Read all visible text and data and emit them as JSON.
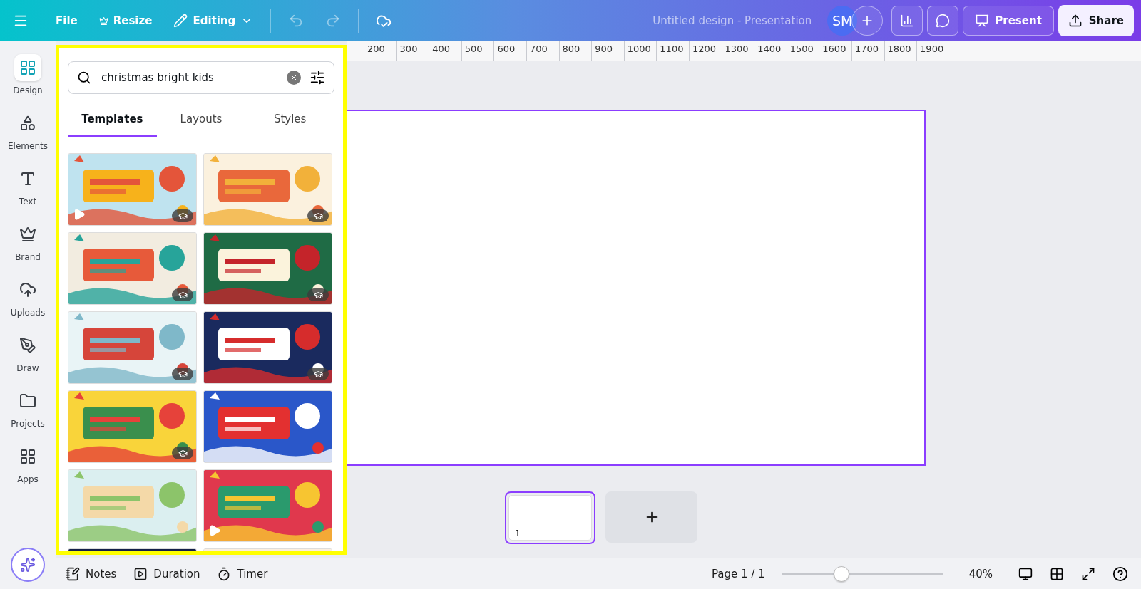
{
  "top_bar": {
    "file": "File",
    "resize": "Resize",
    "mode": "Editing",
    "title": "Untitled design - Presentation",
    "avatar": "SM",
    "present": "Present",
    "share": "Share",
    "undo_disabled": true,
    "redo_disabled": true
  },
  "rail": [
    {
      "label": "Design",
      "kind": "design",
      "selected": true
    },
    {
      "label": "Elements",
      "kind": "elements",
      "selected": false
    },
    {
      "label": "Text",
      "kind": "text",
      "selected": false
    },
    {
      "label": "Brand",
      "kind": "brand",
      "selected": false
    },
    {
      "label": "Uploads",
      "kind": "uploads",
      "selected": false
    },
    {
      "label": "Draw",
      "kind": "draw",
      "selected": false
    },
    {
      "label": "Projects",
      "kind": "projects",
      "selected": false
    },
    {
      "label": "Apps",
      "kind": "apps",
      "selected": false
    }
  ],
  "panel": {
    "search": {
      "value": "christmas bright kids"
    },
    "tabs": [
      {
        "label": "Templates",
        "selected": true
      },
      {
        "label": "Layouts",
        "selected": false
      },
      {
        "label": "Styles",
        "selected": false
      }
    ],
    "templates": [
      {
        "kind": "picture",
        "video": true,
        "badge": true
      },
      {
        "kind": "picture",
        "video": false,
        "badge": true
      },
      {
        "kind": "picture",
        "video": false,
        "badge": true
      },
      {
        "kind": "picture",
        "video": false,
        "badge": true
      },
      {
        "kind": "picture",
        "video": false,
        "badge": true
      },
      {
        "kind": "picture",
        "video": false,
        "badge": true
      },
      {
        "kind": "picture",
        "video": false,
        "badge": true
      },
      {
        "kind": "picture",
        "video": false,
        "badge": false
      },
      {
        "kind": "picture",
        "video": false,
        "badge": false
      },
      {
        "kind": "picture",
        "video": true,
        "badge": false
      },
      {
        "kind": "picture"
      },
      {
        "kind": "picture"
      }
    ]
  },
  "ruler": [
    "200",
    "300",
    "400",
    "500",
    "600",
    "700",
    "800",
    "900",
    "1000",
    "1100",
    "1200",
    "1300",
    "1400",
    "1500",
    "1600",
    "1700",
    "1800",
    "1900"
  ],
  "pages": [
    {
      "number": "1",
      "selected": true
    }
  ],
  "bottom_bar": {
    "notes": "Notes",
    "duration": "Duration",
    "timer": "Timer",
    "page": "Page 1 / 1",
    "zoom": {
      "level": 0.37
    },
    "zoom_reading": "40%"
  }
}
